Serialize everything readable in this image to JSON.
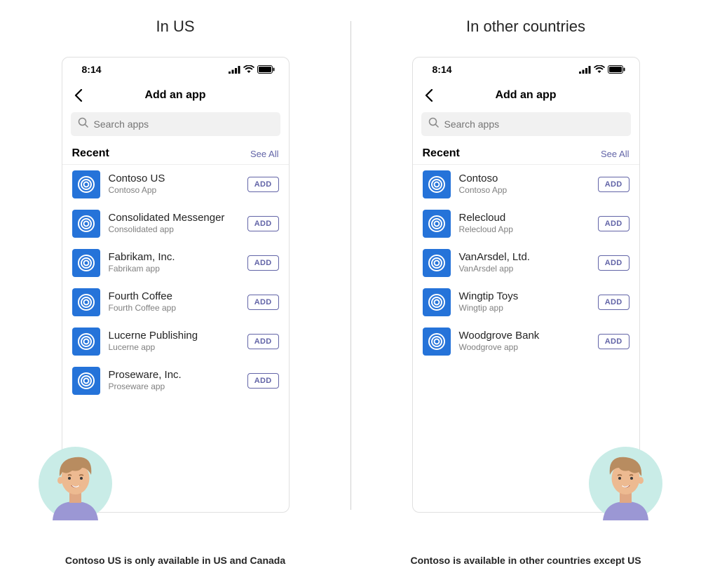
{
  "left": {
    "title": "In US",
    "caption": "Contoso US is only available in US and Canada",
    "time": "8:14",
    "nav_title": "Add an app",
    "search_placeholder": "Search apps",
    "section_title": "Recent",
    "see_all": "See All",
    "add_label": "ADD",
    "apps": [
      {
        "title": "Contoso US",
        "sub": "Contoso App"
      },
      {
        "title": "Consolidated Messenger",
        "sub": "Consolidated app"
      },
      {
        "title": "Fabrikam, Inc.",
        "sub": "Fabrikam app"
      },
      {
        "title": "Fourth Coffee",
        "sub": "Fourth Coffee app"
      },
      {
        "title": "Lucerne Publishing",
        "sub": "Lucerne app"
      },
      {
        "title": "Proseware, Inc.",
        "sub": "Proseware app"
      }
    ]
  },
  "right": {
    "title": "In other countries",
    "caption": "Contoso is available in other countries except US",
    "time": "8:14",
    "nav_title": "Add an app",
    "search_placeholder": "Search apps",
    "section_title": "Recent",
    "see_all": "See All",
    "add_label": "ADD",
    "apps": [
      {
        "title": "Contoso",
        "sub": "Contoso App"
      },
      {
        "title": "Relecloud",
        "sub": "Relecloud App"
      },
      {
        "title": "VanArsdel, Ltd.",
        "sub": "VanArsdel app"
      },
      {
        "title": "Wingtip Toys",
        "sub": "Wingtip app"
      },
      {
        "title": "Woodgrove Bank",
        "sub": "Woodgrove  app"
      }
    ]
  },
  "icons": {
    "search": "search-icon",
    "back": "chevron-left-icon",
    "signal": "signal-icon",
    "wifi": "wifi-icon",
    "battery": "battery-icon",
    "app": "spiral-icon"
  },
  "colors": {
    "accent": "#6264a7",
    "app_icon_bg": "#2573d9"
  }
}
